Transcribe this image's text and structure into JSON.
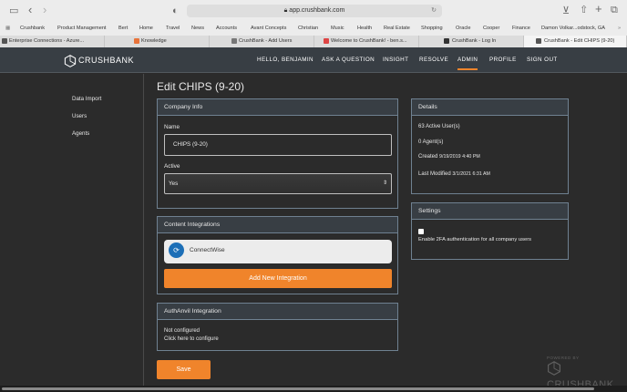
{
  "browser": {
    "url": "app.crushbank.com",
    "bookmarks": [
      "Crushbank",
      "Product Management",
      "Bert",
      "Home",
      "Travel",
      "News",
      "Accounts",
      "Avant Concepts",
      "Christian",
      "Music",
      "Health",
      "Real Estate",
      "Shopping",
      "Oracle",
      "Cooper",
      "Finance",
      "Damon Volkar...odstock, GA"
    ],
    "tabs": [
      "Enterprise Connections - Azure...",
      "Knowledge",
      "CrushBank - Add Users",
      "Welcome to CrushBank! - ben.s...",
      "CrushBank - Log In",
      "CrushBank - Edit CHIPS (9-20)"
    ]
  },
  "app": {
    "logo": "CRUSHBANK",
    "nav": [
      "HELLO, BENJAMIN",
      "ASK A QUESTION",
      "INSIGHT",
      "RESOLVE",
      "ADMIN",
      "PROFILE",
      "SIGN OUT"
    ],
    "active_nav": "ADMIN"
  },
  "sidebar": {
    "items": [
      "Data Import",
      "Users",
      "Agents"
    ]
  },
  "page": {
    "title": "Edit CHIPS (9-20)"
  },
  "company_info": {
    "header": "Company Info",
    "name_label": "Name",
    "name_value": "CHIPS (9-20)",
    "active_label": "Active",
    "active_value": "Yes"
  },
  "content_integrations": {
    "header": "Content Integrations",
    "integration_name": "ConnectWise",
    "add_button": "Add New Integration"
  },
  "authanvil": {
    "header": "AuthAnvil Integration",
    "status": "Not configured",
    "configure_link": "Click here to configure"
  },
  "details": {
    "header": "Details",
    "active_users": "63 Active User(s)",
    "agents": "0 Agent(s)",
    "created_label": "Created",
    "created_value": "9/19/2019 4:40 PM",
    "modified_label": "Last Modified",
    "modified_value": "3/1/2021 6:31 AM"
  },
  "settings": {
    "header": "Settings",
    "twofa_label": "Enable 2FA authentication for all company users",
    "twofa_checked": false
  },
  "save_button": "Save",
  "footer": {
    "powered_by": "POWERED BY",
    "brand": "CRUSHBANK"
  },
  "colors": {
    "accent": "#f0842b",
    "nav_bg": "#383e44",
    "page_bg": "#2b2b2b",
    "panel_border": "#6f8191"
  }
}
